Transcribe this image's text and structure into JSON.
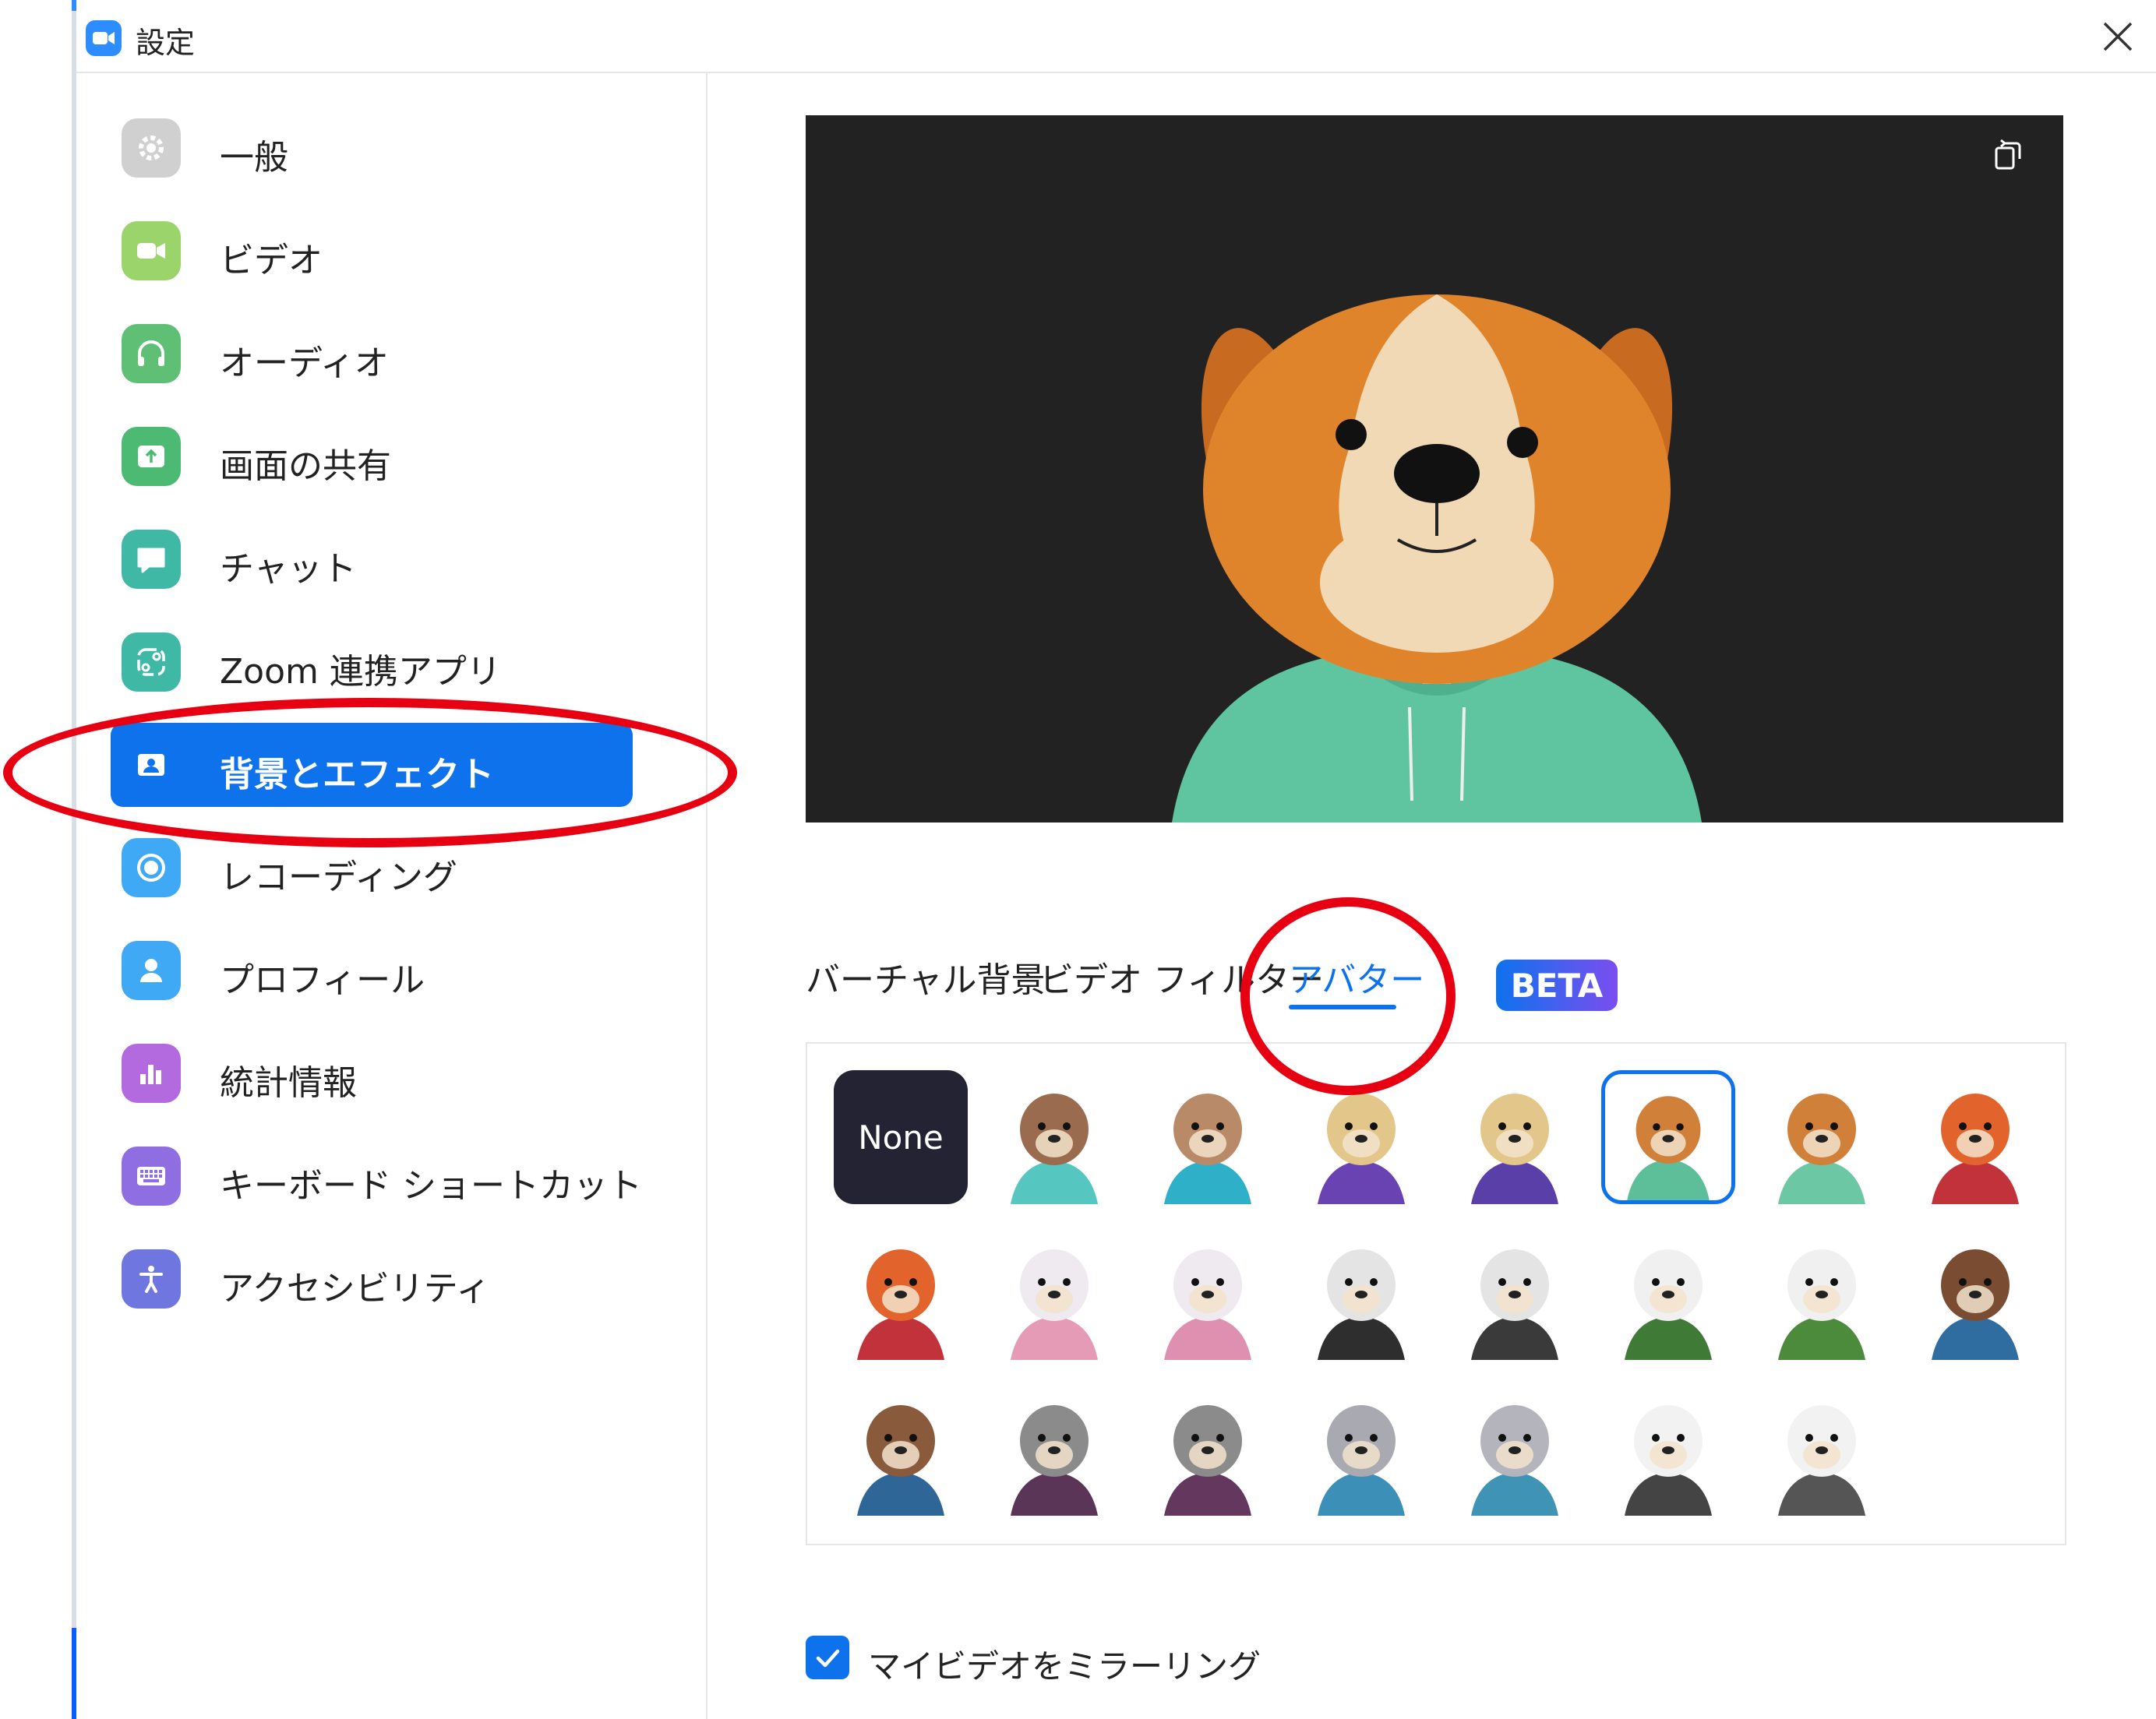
{
  "window": {
    "title": "設定"
  },
  "sidebar": {
    "items": [
      {
        "label": "一般",
        "icon": "gear-icon",
        "color": "#d0d0d0"
      },
      {
        "label": "ビデオ",
        "icon": "video-camera-icon",
        "color": "#9bd46b"
      },
      {
        "label": "オーディオ",
        "icon": "headphones-icon",
        "color": "#5fbf74"
      },
      {
        "label": "画面の共有",
        "icon": "share-screen-icon",
        "color": "#4cba73"
      },
      {
        "label": "チャット",
        "icon": "chat-bubble-icon",
        "color": "#3fb9a6"
      },
      {
        "label": "Zoom 連携アプリ",
        "icon": "apps-icon",
        "color": "#3fb9a6"
      },
      {
        "label": "背景とエフェクト",
        "icon": "background-icon",
        "color": "#0e72ed",
        "active": true
      },
      {
        "label": "レコーディング",
        "icon": "record-icon",
        "color": "#3fa9f5"
      },
      {
        "label": "プロフィール",
        "icon": "profile-icon",
        "color": "#3fa9f5"
      },
      {
        "label": "統計情報",
        "icon": "statistics-icon",
        "color": "#b46adf"
      },
      {
        "label": "キーボード ショートカット",
        "icon": "keyboard-icon",
        "color": "#8e6ee0"
      },
      {
        "label": "アクセシビリティ",
        "icon": "accessibility-icon",
        "color": "#6f76e0"
      }
    ]
  },
  "preview": {
    "background": "#222223",
    "selected_avatar": "dog-teal-hoodie"
  },
  "tabs": [
    {
      "label": "バーチャル背景"
    },
    {
      "label": "ビデオ フィルター"
    },
    {
      "label": "アバター",
      "active": true
    }
  ],
  "beta_badge": "BETA",
  "avatar_grid": {
    "none_label": "None",
    "items": [
      {
        "name": "cat-teal",
        "fur": "#9a6b4e",
        "shirt": "#55c6c0",
        "selected": false
      },
      {
        "name": "cat-cyan",
        "fur": "#b98a68",
        "shirt": "#2fb0c9",
        "selected": false
      },
      {
        "name": "cow-purple",
        "fur": "#e3c78a",
        "shirt": "#6a43b2",
        "selected": false
      },
      {
        "name": "cow-violet",
        "fur": "#e3c78a",
        "shirt": "#5b3fa8",
        "selected": false
      },
      {
        "name": "dog-teal",
        "fur": "#d1803a",
        "shirt": "#5dbf9a",
        "selected": true
      },
      {
        "name": "dog-mint",
        "fur": "#d1803a",
        "shirt": "#6cc7a4",
        "selected": false
      },
      {
        "name": "fox-red",
        "fur": "#e2642c",
        "shirt": "#c2323a",
        "selected": false
      },
      {
        "name": "fox-crimson",
        "fur": "#e2642c",
        "shirt": "#c2323a",
        "selected": false
      },
      {
        "name": "rabbit-pink",
        "fur": "#eeeaf0",
        "shirt": "#e59ab6",
        "selected": false
      },
      {
        "name": "rabbit-rose",
        "fur": "#eeeaf0",
        "shirt": "#df8fb0",
        "selected": false
      },
      {
        "name": "polar-bear-black",
        "fur": "#e4e4e4",
        "shirt": "#2e2e2e",
        "selected": false
      },
      {
        "name": "polar-bear-dark",
        "fur": "#e4e4e4",
        "shirt": "#3a3a3a",
        "selected": false
      },
      {
        "name": "panda-green",
        "fur": "#f0f0f0",
        "shirt": "#3f7a36",
        "selected": false
      },
      {
        "name": "panda-olive",
        "fur": "#f0f0f0",
        "shirt": "#4c8a3c",
        "selected": false
      },
      {
        "name": "otter-blue",
        "fur": "#7a4d33",
        "shirt": "#2f6da0",
        "selected": false
      },
      {
        "name": "otter-navy",
        "fur": "#8a5a3c",
        "shirt": "#2e6698",
        "selected": false
      },
      {
        "name": "raccoon-purple",
        "fur": "#8b8b8b",
        "shirt": "#5a3557",
        "selected": false
      },
      {
        "name": "raccoon-plum",
        "fur": "#8b8b8b",
        "shirt": "#64385e",
        "selected": false
      },
      {
        "name": "cat-grey-blue",
        "fur": "#a9a9b1",
        "shirt": "#3c8fb6",
        "selected": false
      },
      {
        "name": "cat-grey-teal",
        "fur": "#b4b4bc",
        "shirt": "#3f93b5",
        "selected": false
      },
      {
        "name": "cow-bw-dark",
        "fur": "#f2f2f2",
        "shirt": "#444444",
        "selected": false
      },
      {
        "name": "cow-bw-grey",
        "fur": "#f2f2f2",
        "shirt": "#555555",
        "selected": false
      }
    ]
  },
  "mirror": {
    "label": "マイビデオをミラーリング",
    "checked": true
  },
  "accent": "#0e72ed",
  "annotation_color": "#e60012"
}
